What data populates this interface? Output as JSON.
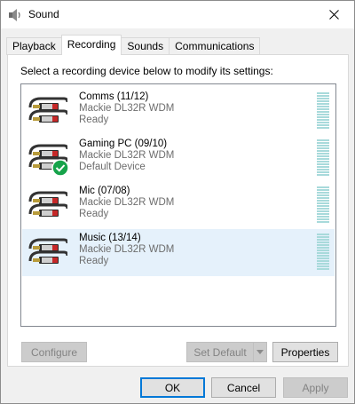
{
  "window": {
    "title": "Sound"
  },
  "tabs": [
    {
      "label": "Playback"
    },
    {
      "label": "Recording"
    },
    {
      "label": "Sounds"
    },
    {
      "label": "Communications"
    }
  ],
  "instruction": "Select a recording device below to modify its settings:",
  "devices": [
    {
      "name": "Comms (11/12)",
      "driver": "Mackie DL32R WDM",
      "status": "Ready",
      "is_default": false,
      "selected": false
    },
    {
      "name": "Gaming PC (09/10)",
      "driver": "Mackie DL32R WDM",
      "status": "Default Device",
      "is_default": true,
      "selected": false
    },
    {
      "name": "Mic (07/08)",
      "driver": "Mackie DL32R WDM",
      "status": "Ready",
      "is_default": false,
      "selected": false
    },
    {
      "name": "Music (13/14)",
      "driver": "Mackie DL32R WDM",
      "status": "Ready",
      "is_default": false,
      "selected": true
    }
  ],
  "panel_buttons": {
    "configure": "Configure",
    "set_default": "Set Default",
    "properties": "Properties"
  },
  "dialog_buttons": {
    "ok": "OK",
    "cancel": "Cancel",
    "apply": "Apply"
  },
  "colors": {
    "accent": "#0078d7",
    "selection": "#e5f1fb",
    "level_meter": "#a8dadb",
    "default_check": "#16a34a"
  }
}
